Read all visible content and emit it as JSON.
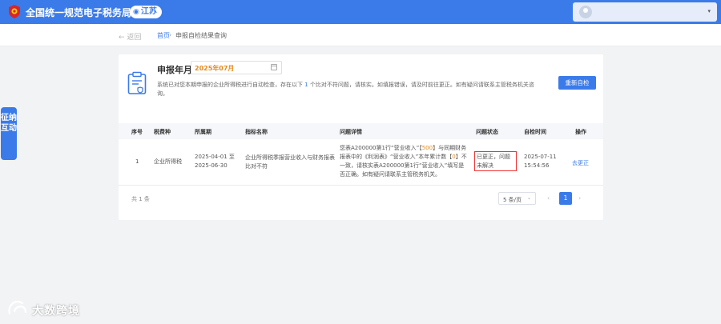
{
  "header": {
    "title": "全国统一规范电子税务局",
    "region": "江苏",
    "user_caret": "▾"
  },
  "breadcrumb": {
    "back": "← 返回",
    "home": "首页",
    "sep": "›",
    "current": "申报自检结果查询"
  },
  "side_float": {
    "label": "征纳互动"
  },
  "period": {
    "label": "申报年月",
    "value": "2025年07月"
  },
  "notice": {
    "pre": "系统已对您本期申报的企业所得税进行自动检查，存在以下",
    "count": "1",
    "post": "个比对不符问题，请核实。如填报错误，请及时前往更正。如有疑问请联系主管税务机关咨询。"
  },
  "recheck_button": "重新自检",
  "table": {
    "headers": [
      "序号",
      "税费种",
      "所属期",
      "指标名称",
      "问题详情",
      "问题状态",
      "自检时间",
      "操作"
    ],
    "rows": [
      {
        "index": "1",
        "tax_type": "企业所得税",
        "period_from": "2025-04-01 至",
        "period_to": "2025-06-30",
        "indicator": "企业所得税季报营业收入与财务报表比对不符",
        "detail_a": "您表A200000第1行“营业收入”【",
        "detail_v1": "500",
        "detail_b": "】与同期财务报表中的《利润表》“营业收入”本年累计数【",
        "detail_v2": "0",
        "detail_c": "】不一致，请核实表A200000第1行“营业收入”填写是否正确。如有疑问请联系主管税务机关。",
        "status": "已更正，问题未解决",
        "check_time_date": "2025-07-11",
        "check_time_clock": "15:54:56",
        "action": "去更正"
      }
    ]
  },
  "pagination": {
    "total": "共 1 条",
    "page_size": "5 条/页",
    "size_caret": "⌄",
    "prev": "‹",
    "current": "1",
    "next": "›"
  },
  "watermark": {
    "text": "大数跨境"
  },
  "colors": {
    "primary": "#3b7be9",
    "highlight": "#e58a1f",
    "status_border": "#e33333"
  }
}
